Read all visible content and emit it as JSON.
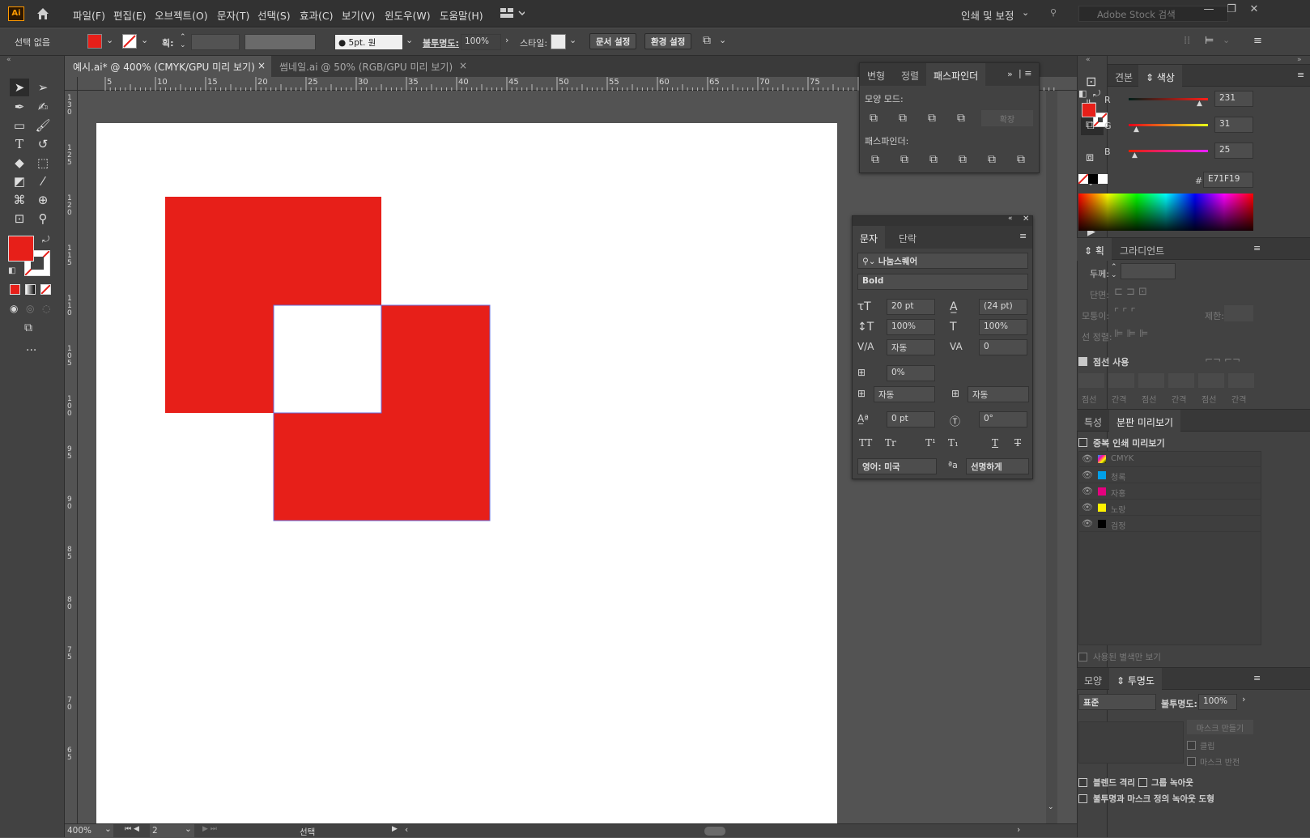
{
  "app": {
    "logo": "Ai",
    "workspace": "인쇄 및 보정",
    "stock_placeholder": "Adobe Stock 검색"
  },
  "menu": [
    "파일(F)",
    "편집(E)",
    "오브젝트(O)",
    "문자(T)",
    "선택(S)",
    "효과(C)",
    "보기(V)",
    "윈도우(W)",
    "도움말(H)"
  ],
  "control": {
    "selection": "선택 없음",
    "stroke_label": "획:",
    "brush": "5pt. 원",
    "opacity_label": "불투명도:",
    "opacity": "100%",
    "style_label": "스타일:",
    "doc_setup": "문서 설정",
    "prefs": "환경 설정"
  },
  "tabs": [
    {
      "label": "예시.ai* @ 400% (CMYK/GPU 미리 보기)",
      "close": "×"
    },
    {
      "label": "썸네일.ai @ 50% (RGB/GPU 미리 보기)",
      "close": "×"
    }
  ],
  "ruler_h": [
    "5",
    "10",
    "15",
    "20",
    "25",
    "30",
    "35",
    "40",
    "45",
    "50",
    "55",
    "60",
    "65",
    "70",
    "75"
  ],
  "ruler_v": [
    "1 3 0",
    "1 2 5",
    "1 2 0",
    "1 1 5",
    "1 1 0",
    "1 0 5",
    "1 0 0",
    "9 5",
    "9 0",
    "8 5",
    "8 0",
    "7 5",
    "7 0",
    "6 5"
  ],
  "colors": {
    "fill": "#E71F19",
    "artboard": "#FFFFFF",
    "ui_bg": "#535353"
  },
  "pathfinder": {
    "tabs": [
      "변형",
      "정렬",
      "패스파인더"
    ],
    "shape_modes_label": "모양 모드:",
    "expand": "확장",
    "pathfinders_label": "패스파인더:"
  },
  "character": {
    "tabs": [
      "문자",
      "단락"
    ],
    "font": "나눔스퀘어",
    "style": "Bold",
    "size": "20 pt",
    "leading": "(24 pt)",
    "vscale": "100%",
    "hscale": "100%",
    "kerning": "자동",
    "tracking": "0",
    "tsume": "0%",
    "aki_left": "자동",
    "aki_right": "자동",
    "baseline": "0 pt",
    "rotation": "0°",
    "language": "영어: 미국",
    "aa": "선명하게",
    "text_buttons": [
      "TT",
      "Tr",
      "T¹",
      "T₁",
      "T",
      "T"
    ]
  },
  "color_panel": {
    "tabs": [
      "견본",
      "색상"
    ],
    "r": "231",
    "g": "31",
    "b": "25",
    "hex": "E71F19",
    "r_label": "R",
    "g_label": "G",
    "b_label": "B",
    "hash": "#"
  },
  "stroke_panel": {
    "tabs": [
      "획",
      "그라디언트"
    ],
    "weight_label": "두께:",
    "cap_label": "단면:",
    "corner_label": "모퉁이:",
    "limit_label": "제한:",
    "align_label": "선 정렬:",
    "dashed_label": "점선 사용",
    "dash_labels": [
      "점선",
      "간격",
      "점선",
      "간격",
      "점선",
      "간격"
    ]
  },
  "sep_panel": {
    "tabs": [
      "특성",
      "분판 미리보기"
    ],
    "overprint": "중복 인쇄 미리보기",
    "plates": [
      "CMYK",
      "청록",
      "자홍",
      "노랑",
      "검정"
    ],
    "spot_only": "사용된 별색만 보기"
  },
  "transparency": {
    "tabs": [
      "모양",
      "투명도"
    ],
    "mode": "표준",
    "opacity_label": "불투명도:",
    "opacity": "100%",
    "make_mask": "마스크 만들기",
    "clip": "클립",
    "invert": "마스크 반전",
    "isolate": "블렌드 격리",
    "knockout": "그룹 녹아웃",
    "opacity_mask": "불투명과 마스크 정의 녹아웃 도형"
  },
  "status": {
    "zoom": "400%",
    "artboard": "2",
    "tool": "선택"
  }
}
